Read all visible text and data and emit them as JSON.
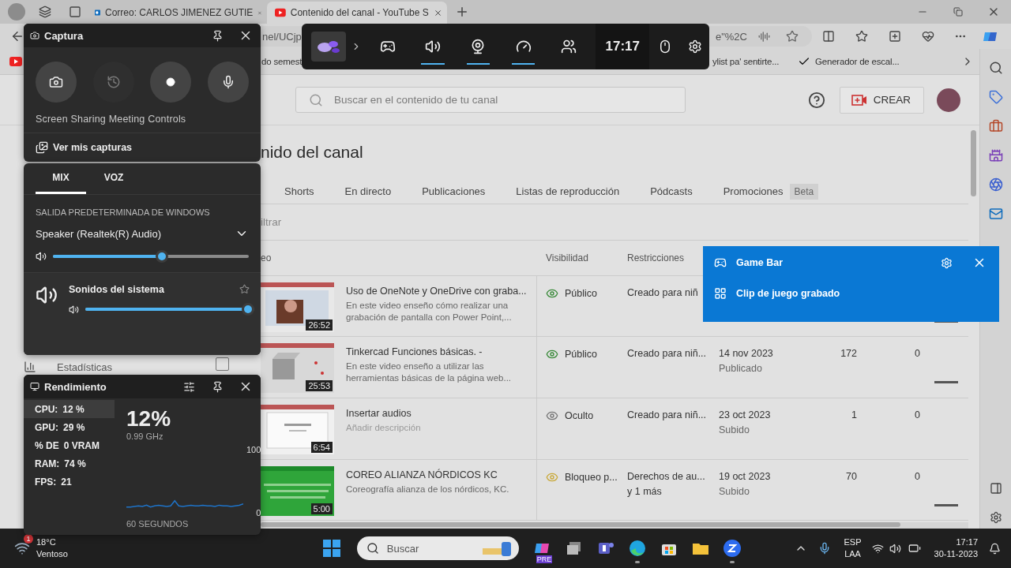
{
  "browser": {
    "tabs": [
      {
        "kind": "mail",
        "title": "Correo: CARLOS JIMENEZ GUTIE",
        "selected": false
      },
      {
        "kind": "video",
        "title": "Contenido del canal - YouTube S",
        "selected": true
      }
    ],
    "address": {
      "start": "nel/UCjp",
      "end": "e\"%2C"
    },
    "bookmarks": [
      {
        "kind": "text",
        "label": "do semest"
      },
      {
        "kind": "text",
        "label": "ylist pa' sentirte..."
      },
      {
        "kind": "check",
        "label": "Generador de escal..."
      }
    ]
  },
  "studio": {
    "search_placeholder": "Buscar en el contenido de tu canal",
    "create_label": "CREAR",
    "title": "nido del canal",
    "nav": [
      {
        "label": "Estadísticas"
      }
    ],
    "row_checkbox": {
      "checked": false
    },
    "tabs": [
      {
        "label": "Shorts"
      },
      {
        "label": "En directo"
      },
      {
        "label": "Publicaciones"
      },
      {
        "label": "Listas de reproducción"
      },
      {
        "label": "Pódcasts"
      },
      {
        "label": "Promociones",
        "badge": "Beta"
      }
    ],
    "filter_placeholder": "iltrar",
    "columns": [
      "eo",
      "Visibilidad",
      "Restricciones"
    ],
    "rows": [
      {
        "title": "Uso de OneNote y OneDrive con graba...",
        "description": "En este video enseño cómo realizar una grabación de pantalla con Power Point,...",
        "duration": "26:52",
        "visibility": "Público",
        "kind": "public",
        "restriction": "Creado para niñ",
        "rating_bar": true
      },
      {
        "title": "Tinkercad Funciones básicas. -",
        "description": "En este video enseño a utilizar las herramientas básicas de la página web...",
        "duration": "25:53",
        "visibility": "Público",
        "kind": "public",
        "restriction": "Creado para niñ...",
        "date": "14 nov 2023",
        "status": "Publicado",
        "views": "172",
        "comments": "0",
        "rating_bar": true
      },
      {
        "title": "Insertar audios",
        "description_placeholder": "Añadir descripción",
        "duration": "6:54",
        "visibility": "Oculto",
        "kind": "hidden",
        "restriction": "Creado para niñ...",
        "date": "23 oct 2023",
        "status": "Subido",
        "views": "1",
        "comments": "0",
        "rating_bar": false
      },
      {
        "title": "COREO ALIANZA NÓRDICOS KC",
        "description": "Coreografía alianza de los nórdicos, KC.",
        "duration": "5:00",
        "visibility": "Bloqueo p...",
        "kind": "blocked",
        "restriction": "Derechos de au...",
        "restriction_more": "y 1 más",
        "date": "19 oct 2023",
        "status": "Subido",
        "views": "70",
        "comments": "0",
        "rating_bar": true
      }
    ]
  },
  "game_bar": {
    "widgets": [
      {
        "kind": "gallery",
        "active": false
      },
      {
        "kind": "audio",
        "active": true
      },
      {
        "kind": "capture",
        "active": true
      },
      {
        "kind": "performance",
        "active": true
      },
      {
        "kind": "social",
        "active": false
      }
    ],
    "time": "17:17"
  },
  "capture": {
    "title": "Captura",
    "buttons": [
      {
        "kind": "screenshot",
        "disabled": false
      },
      {
        "kind": "record-last",
        "disabled": true
      },
      {
        "kind": "record",
        "disabled": false
      },
      {
        "kind": "microphone",
        "disabled": false
      }
    ],
    "meeting_label": "Screen Sharing Meeting Controls",
    "gallery_link": "Ver mis capturas"
  },
  "audio": {
    "tabs": [
      {
        "label": "MIX",
        "selected": true
      },
      {
        "label": "VOZ",
        "selected": false
      }
    ],
    "section": "SALIDA PREDETERMINADA DE WINDOWS",
    "device": "Speaker (Realtek(R) Audio)",
    "level": 0.56,
    "apps": [
      {
        "name": "Sonidos del sistema",
        "level": 1,
        "favorite": false
      }
    ]
  },
  "performance": {
    "title": "Rendimiento",
    "metrics": [
      {
        "label": "CPU:",
        "value": "12 %",
        "selected": true
      },
      {
        "label": "GPU:",
        "value": "29 %",
        "selected": false
      },
      {
        "label": "% DE",
        "value": "0 VRAM",
        "selected": false
      },
      {
        "label": "RAM:",
        "value": "74 %",
        "selected": false
      },
      {
        "label": "FPS:",
        "value": "21",
        "selected": false
      }
    ],
    "big_value": "12%",
    "frequency": "0.99 GHz",
    "chart_data": {
      "type": "line",
      "xlabel": "60 SEGUNDOS",
      "ylim": [
        0,
        100
      ],
      "yticks": [
        0,
        100
      ],
      "series": [
        {
          "color": "#1e73c8",
          "values": [
            9,
            9,
            10,
            11,
            10,
            12,
            9,
            11,
            12,
            11,
            10,
            11,
            19,
            11,
            10,
            11,
            12,
            11,
            11,
            12,
            11,
            11,
            10,
            12,
            11,
            11,
            10,
            11,
            12,
            14
          ]
        }
      ]
    }
  },
  "notification": {
    "title": "Game Bar",
    "message": "Clip de juego grabado"
  },
  "taskbar": {
    "weather": {
      "badge": "1",
      "temperature": "18°C",
      "condition": "Ventoso"
    },
    "search_placeholder": "Buscar",
    "apps": [
      {
        "kind": "copilot",
        "badge": "PRE",
        "running": false
      },
      {
        "kind": "task-view",
        "running": false
      },
      {
        "kind": "teams",
        "running": false
      },
      {
        "kind": "edge",
        "running": true
      },
      {
        "kind": "store",
        "running": false
      },
      {
        "kind": "explorer",
        "running": false
      },
      {
        "kind": "zoom",
        "running": true
      }
    ],
    "language": "ESP",
    "layout": "LAA",
    "time": "17:17",
    "date": "30-11-2023"
  }
}
